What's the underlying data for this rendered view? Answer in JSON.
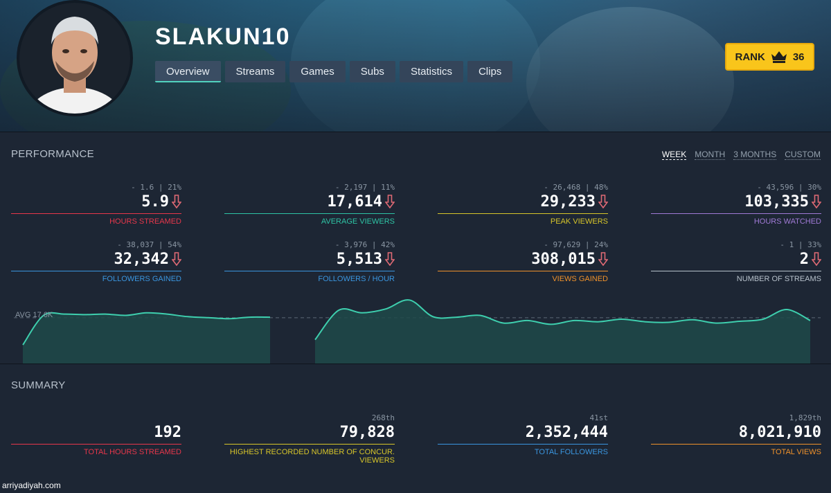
{
  "header": {
    "channel_name": "SLAKUN10",
    "tabs": [
      {
        "label": "Overview",
        "active": true
      },
      {
        "label": "Streams",
        "active": false
      },
      {
        "label": "Games",
        "active": false
      },
      {
        "label": "Subs",
        "active": false
      },
      {
        "label": "Statistics",
        "active": false
      },
      {
        "label": "Clips",
        "active": false
      }
    ],
    "rank": {
      "label": "RANK",
      "icon": "crown-icon",
      "value": "36"
    }
  },
  "performance": {
    "title": "PERFORMANCE",
    "periods": [
      {
        "label": "WEEK",
        "active": true
      },
      {
        "label": "MONTH",
        "active": false
      },
      {
        "label": "3 MONTHS",
        "active": false
      },
      {
        "label": "CUSTOM",
        "active": false
      }
    ],
    "stats": [
      {
        "delta": "- 1.6 | 21%",
        "value": "5.9",
        "label": "HOURS STREAMED",
        "color": "#e8374b",
        "trend": "down"
      },
      {
        "delta": "- 2,197 | 11%",
        "value": "17,614",
        "label": "AVERAGE VIEWERS",
        "color": "#2ec4a5",
        "trend": "down"
      },
      {
        "delta": "- 26,468 | 48%",
        "value": "29,233",
        "label": "PEAK VIEWERS",
        "color": "#d8c62a",
        "trend": "down"
      },
      {
        "delta": "- 43,596 | 30%",
        "value": "103,335",
        "label": "HOURS WATCHED",
        "color": "#a07ad6",
        "trend": "down"
      },
      {
        "delta": "- 38,037 | 54%",
        "value": "32,342",
        "label": "FOLLOWERS GAINED",
        "color": "#3a96e0",
        "trend": "down"
      },
      {
        "delta": "- 3,976 | 42%",
        "value": "5,513",
        "label": "FOLLOWERS / HOUR",
        "color": "#3a96e0",
        "trend": "down"
      },
      {
        "delta": "- 97,629 | 24%",
        "value": "308,015",
        "label": "VIEWS GAINED",
        "color": "#f0922b",
        "trend": "down"
      },
      {
        "delta": "- 1 | 33%",
        "value": "2",
        "label": "NUMBER OF STREAMS",
        "color": "#b8c2cc",
        "trend": "down"
      }
    ],
    "avg_label": "AVG 17.6K",
    "down_arrow_color": "#e06a75"
  },
  "chart_data": {
    "type": "area",
    "series": [
      {
        "values": [
          7,
          18.5,
          19,
          18.8,
          19,
          18.5,
          19.5,
          19,
          18,
          17.6,
          17.2,
          17.8,
          17.8
        ]
      },
      {
        "values": [
          9,
          20.5,
          19.5,
          21,
          24.5,
          18,
          17.8,
          18.5,
          15.5,
          16.5,
          15,
          16.5,
          16,
          17,
          16,
          15.8,
          16.8,
          15.5,
          16.2,
          17,
          20.8,
          16.5
        ]
      }
    ],
    "average": 17.6,
    "ylim": [
      0,
      27
    ],
    "color": "#3ecfae"
  },
  "summary": {
    "title": "SUMMARY",
    "stats": [
      {
        "rank": "",
        "value": "192",
        "label": "TOTAL HOURS STREAMED",
        "color": "#e8374b"
      },
      {
        "rank": "268th",
        "value": "79,828",
        "label": "HIGHEST RECORDED NUMBER OF CONCUR. VIEWERS",
        "color": "#d8c62a"
      },
      {
        "rank": "41st",
        "value": "2,352,444",
        "label": "TOTAL FOLLOWERS",
        "color": "#3a96e0"
      },
      {
        "rank": "1,829th",
        "value": "8,021,910",
        "label": "TOTAL VIEWS",
        "color": "#f0922b"
      }
    ]
  },
  "watermark": "arriyadiyah.com"
}
